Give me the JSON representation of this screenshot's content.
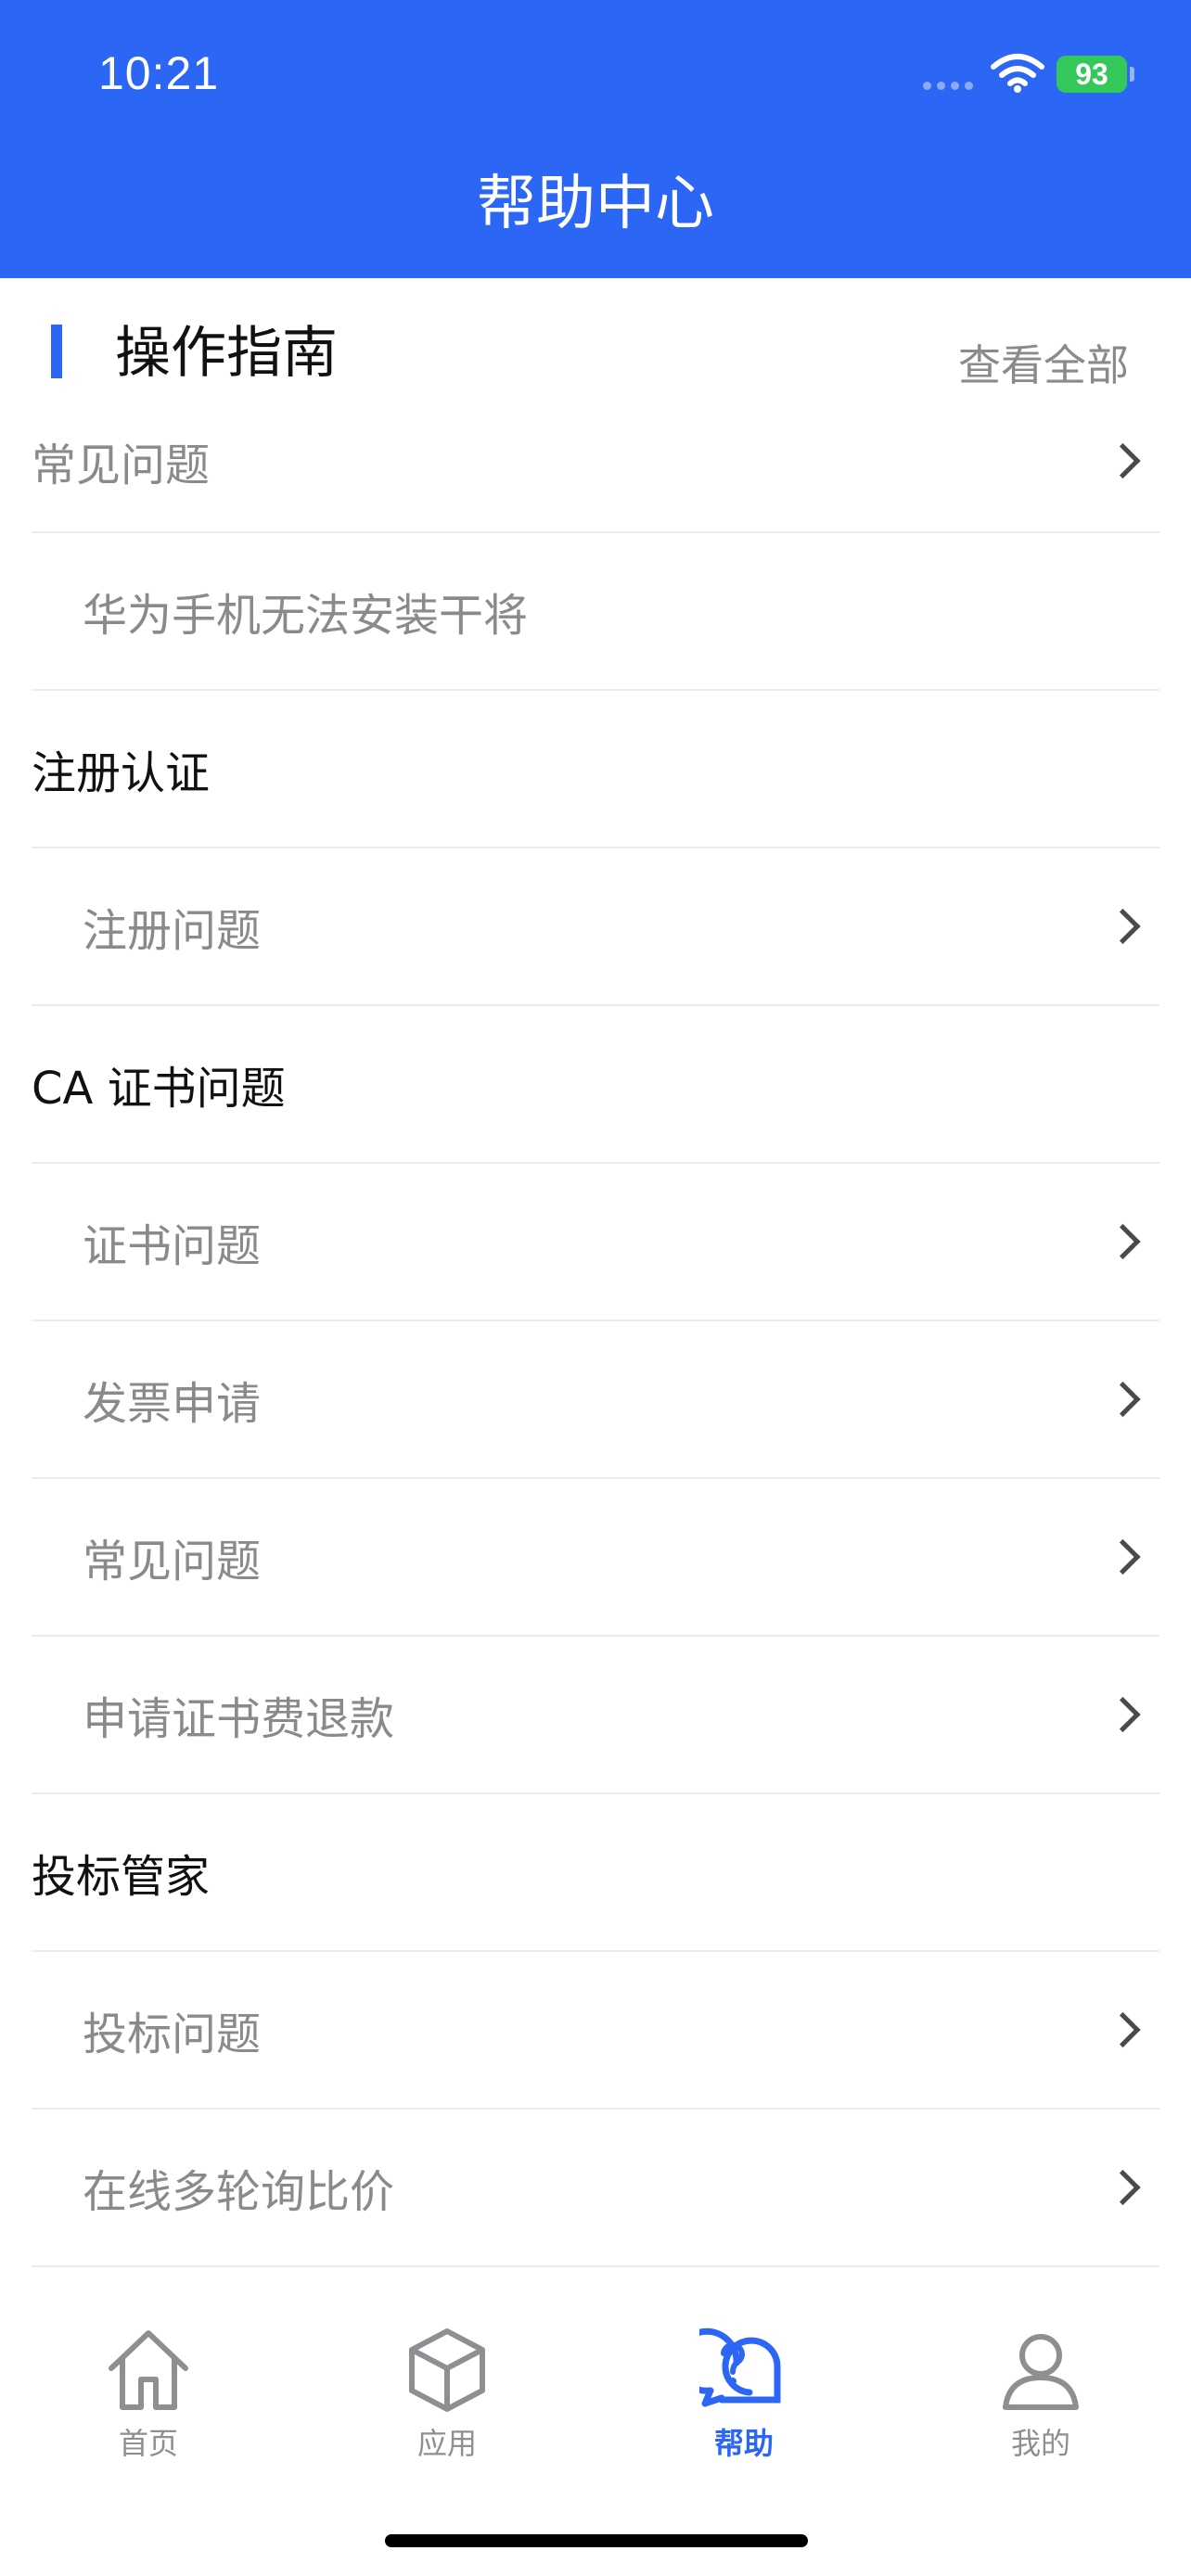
{
  "status_bar": {
    "time": "10:21",
    "battery": "93"
  },
  "header": {
    "title": "帮助中心"
  },
  "section": {
    "title": "操作指南",
    "view_all": "查看全部"
  },
  "list": [
    {
      "label": "常见问题",
      "kind": "top-item",
      "chevron": true
    },
    {
      "label": "华为手机无法安装干将",
      "kind": "item",
      "chevron": false
    },
    {
      "label": "注册认证",
      "kind": "category",
      "chevron": false
    },
    {
      "label": "注册问题",
      "kind": "item",
      "chevron": true
    },
    {
      "label": "CA 证书问题",
      "kind": "category",
      "chevron": false
    },
    {
      "label": "证书问题",
      "kind": "item",
      "chevron": true
    },
    {
      "label": "发票申请",
      "kind": "item",
      "chevron": true
    },
    {
      "label": "常见问题",
      "kind": "item",
      "chevron": true
    },
    {
      "label": "申请证书费退款",
      "kind": "item",
      "chevron": true
    },
    {
      "label": "投标管家",
      "kind": "category",
      "chevron": false
    },
    {
      "label": "投标问题",
      "kind": "item",
      "chevron": true
    },
    {
      "label": "在线多轮询比价",
      "kind": "item",
      "chevron": true
    }
  ],
  "tabbar": {
    "tabs": [
      {
        "label": "首页",
        "icon": "home-icon",
        "active": false
      },
      {
        "label": "应用",
        "icon": "cube-icon",
        "active": false
      },
      {
        "label": "帮助",
        "icon": "help-chat-icon",
        "active": true
      },
      {
        "label": "我的",
        "icon": "person-icon",
        "active": false
      }
    ]
  },
  "colors": {
    "accent": "#2b66f5",
    "battery": "#34c759",
    "muted_text": "#8a8a8a"
  }
}
